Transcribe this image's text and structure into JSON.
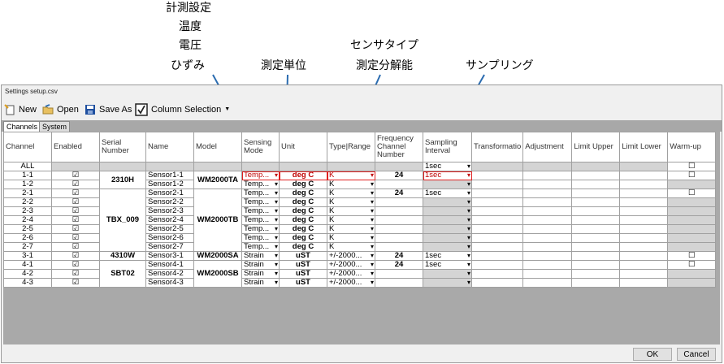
{
  "annotations": {
    "sensing_mode": [
      "計測設定",
      "温度",
      "電圧",
      "ひずみ"
    ],
    "unit": "測定単位",
    "type_range": [
      "センサタイプ",
      "測定分解能"
    ],
    "sampling": "サンプリング"
  },
  "window": {
    "title": "Settings setup.csv"
  },
  "toolbar": {
    "new": "New",
    "open": "Open",
    "save_as": "Save As",
    "column_selection": "Column Selection"
  },
  "tabs": [
    "Channels",
    "System"
  ],
  "columns": [
    "Channel",
    "Enabled",
    "Serial Number",
    "Name",
    "Model",
    "Sensing Mode",
    "Unit",
    "Type|Range",
    "Frequency Channel Number",
    "Sampling Interval",
    "Transformatio",
    "Adjustment",
    "Limit Upper",
    "Limit Lower",
    "Warm-up"
  ],
  "checkmark": "☑",
  "rows": [
    {
      "channel": "ALL",
      "enabled": "",
      "serial": "",
      "name": "",
      "model": "",
      "mode": "",
      "unit": "",
      "type": "",
      "freq": "",
      "sampling": "1sec",
      "warmup": "☐"
    },
    {
      "channel": "1-1",
      "enabled": "☑",
      "serial": "2310H",
      "name": "Sensor1-1",
      "model": "WM2000TA",
      "mode": "Temp...",
      "unit": "deg C",
      "type": "K",
      "freq": "24",
      "sampling": "1sec",
      "warmup": "☐"
    },
    {
      "channel": "1-2",
      "enabled": "☑",
      "serial": "",
      "name": "Sensor1-2",
      "model": "",
      "mode": "Temp...",
      "unit": "deg C",
      "type": "K",
      "freq": "",
      "sampling": "",
      "warmup": ""
    },
    {
      "channel": "2-1",
      "enabled": "☑",
      "serial": "TBX_009",
      "name": "Sensor2-1",
      "model": "WM2000TB",
      "mode": "Temp...",
      "unit": "deg C",
      "type": "K",
      "freq": "24",
      "sampling": "1sec",
      "warmup": "☐"
    },
    {
      "channel": "2-2",
      "enabled": "☑",
      "serial": "",
      "name": "Sensor2-2",
      "model": "",
      "mode": "Temp...",
      "unit": "deg C",
      "type": "K",
      "freq": "",
      "sampling": "",
      "warmup": ""
    },
    {
      "channel": "2-3",
      "enabled": "☑",
      "serial": "",
      "name": "Sensor2-3",
      "model": "",
      "mode": "Temp...",
      "unit": "deg C",
      "type": "K",
      "freq": "",
      "sampling": "",
      "warmup": ""
    },
    {
      "channel": "2-4",
      "enabled": "☑",
      "serial": "",
      "name": "Sensor2-4",
      "model": "",
      "mode": "Temp...",
      "unit": "deg C",
      "type": "K",
      "freq": "",
      "sampling": "",
      "warmup": ""
    },
    {
      "channel": "2-5",
      "enabled": "☑",
      "serial": "",
      "name": "Sensor2-5",
      "model": "",
      "mode": "Temp...",
      "unit": "deg C",
      "type": "K",
      "freq": "",
      "sampling": "",
      "warmup": ""
    },
    {
      "channel": "2-6",
      "enabled": "☑",
      "serial": "",
      "name": "Sensor2-6",
      "model": "",
      "mode": "Temp...",
      "unit": "deg C",
      "type": "K",
      "freq": "",
      "sampling": "",
      "warmup": ""
    },
    {
      "channel": "2-7",
      "enabled": "☑",
      "serial": "",
      "name": "Sensor2-7",
      "model": "",
      "mode": "Temp...",
      "unit": "deg C",
      "type": "K",
      "freq": "",
      "sampling": "",
      "warmup": ""
    },
    {
      "channel": "3-1",
      "enabled": "☑",
      "serial": "4310W",
      "name": "Sensor3-1",
      "model": "WM2000SA",
      "mode": "Strain",
      "unit": "uST",
      "type": "+/-2000...",
      "freq": "24",
      "sampling": "1sec",
      "warmup": "☐"
    },
    {
      "channel": "4-1",
      "enabled": "☑",
      "serial": "SBT02",
      "name": "Sensor4-1",
      "model": "WM2000SB",
      "mode": "Strain",
      "unit": "uST",
      "type": "+/-2000...",
      "freq": "24",
      "sampling": "1sec",
      "warmup": "☐"
    },
    {
      "channel": "4-2",
      "enabled": "☑",
      "serial": "",
      "name": "Sensor4-2",
      "model": "",
      "mode": "Strain",
      "unit": "uST",
      "type": "+/-2000...",
      "freq": "",
      "sampling": "",
      "warmup": ""
    },
    {
      "channel": "4-3",
      "enabled": "☑",
      "serial": "",
      "name": "Sensor4-3",
      "model": "",
      "mode": "Strain",
      "unit": "uST",
      "type": "+/-2000...",
      "freq": "",
      "sampling": "",
      "warmup": ""
    }
  ],
  "buttons": {
    "ok": "OK",
    "cancel": "Cancel"
  },
  "colors": {
    "highlight": "#e02020",
    "tab_strip": "#a8a8a8",
    "empty_area": "#a9a9a9",
    "disabled_cell": "#d4d4d4"
  }
}
